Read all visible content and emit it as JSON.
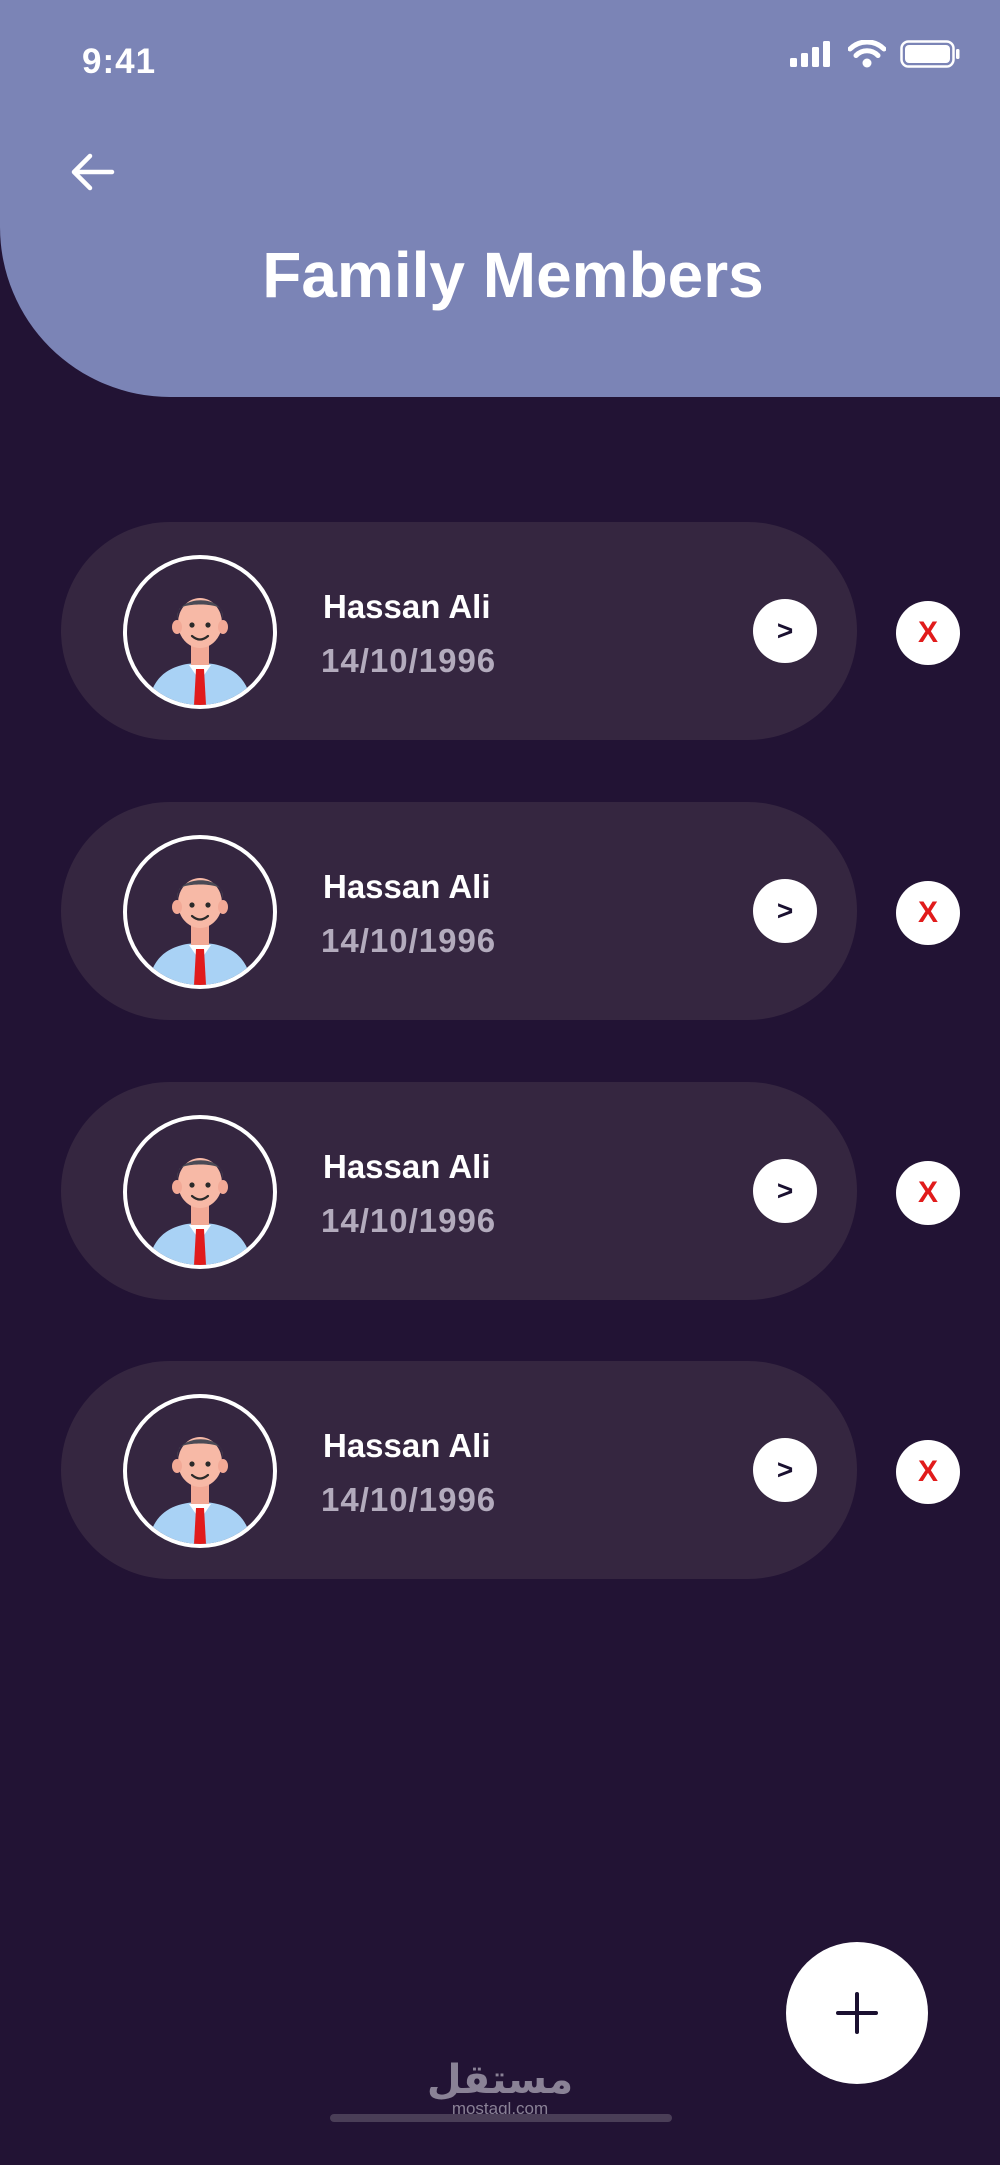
{
  "status_bar": {
    "time": "9:41"
  },
  "header": {
    "title": "Family Members"
  },
  "members": [
    {
      "name": "Hassan Ali",
      "dob": "14/10/1996",
      "open_label": ">",
      "delete_label": "X"
    },
    {
      "name": "Hassan Ali",
      "dob": "14/10/1996",
      "open_label": ">",
      "delete_label": "X"
    },
    {
      "name": "Hassan Ali",
      "dob": "14/10/1996",
      "open_label": ">",
      "delete_label": "X"
    },
    {
      "name": "Hassan Ali",
      "dob": "14/10/1996",
      "open_label": ">",
      "delete_label": "X"
    }
  ],
  "watermark": {
    "arabic": "مستقل",
    "latin": "mostaql.com"
  },
  "icons": {
    "back": "arrow-left-icon",
    "signal": "signal-icon",
    "wifi": "wifi-icon",
    "battery": "battery-icon",
    "add": "plus-icon",
    "avatar": "person-avatar-icon"
  },
  "colors": {
    "background": "#221334",
    "header": "#7b84b6",
    "card": "#352640",
    "delete": "#e11b1b"
  }
}
